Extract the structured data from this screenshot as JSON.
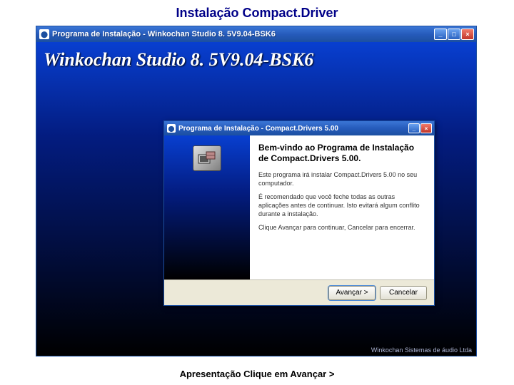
{
  "slide": {
    "title": "Instalação Compact.Driver",
    "caption": "Apresentação Clique em Avançar >"
  },
  "outer": {
    "title": "Programa de Instalação - Winkochan Studio 8. 5V9.04-BSK6",
    "heading": "Winkochan Studio 8. 5V9.04-BSK6",
    "footer": "Winkochan Sistemas de áudio Ltda"
  },
  "inner": {
    "title": "Programa de Instalação - Compact.Drivers 5.00",
    "heading": "Bem-vindo ao Programa de Instalação de Compact.Drivers 5.00.",
    "p1": "Este programa irá instalar Compact.Drivers 5.00 no seu computador.",
    "p2": "É recomendado que você feche todas as outras aplicações antes de continuar. Isto evitará algum conflito durante a instalação.",
    "p3": "Clique Avançar para continuar, Cancelar para encerrar.",
    "buttons": {
      "next": "Avançar >",
      "cancel": "Cancelar"
    }
  }
}
